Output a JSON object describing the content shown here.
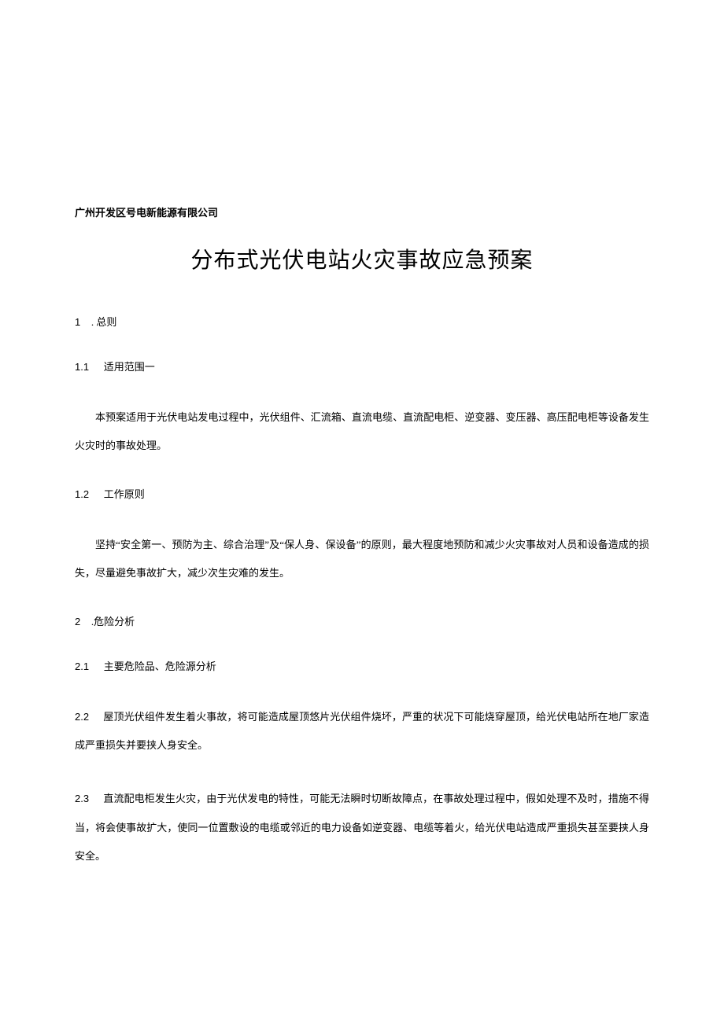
{
  "company": "广州开发区号电新能源有限公司",
  "title": "分布式光伏电站火灾事故应急预案",
  "s1": {
    "num": "1",
    "label": ". 总则"
  },
  "s1_1": {
    "num": "1.1",
    "label": "适用范围一"
  },
  "p1": "本预案适用于光伏电站发电过程中，光伏组件、汇流箱、直流电缆、直流配电柜、逆变器、变压器、高压配电柜等设备发生火灾时的事故处理。",
  "s1_2": {
    "num": "1.2",
    "label": "工作原则"
  },
  "p2": "坚持“安全第一、预防为主、综合治理”及“保人身、保设备”的原则，最大程度地预防和减少火灾事故对人员和设备造成的损失，尽量避免事故扩大，减少次生灾难的发生。",
  "s2": {
    "num": "2",
    "label": ".危险分析"
  },
  "s2_1": {
    "num": "2.1",
    "label": "主要危险品、危险源分析"
  },
  "s2_2": {
    "num": "2.2",
    "label": "屋顶光伏组件发生着火事故，将可能造成屋顶悠片光伏组件烧坏，严重的状况下可能烧穿屋顶，给光伏电站所在地厂家造成严重损失并要挟人身安全。"
  },
  "s2_3": {
    "num": "2.3",
    "label": "直流配电柜发生火灾，由于光伏发电的特性，可能无法瞬时切断故障点，在事故处理过程中，假如处理不及时，措施不得当，将会使事故扩大，使同一位置敷设的电缆或邻近的电力设备如逆变器、电缆等着火，给光伏电站造成严重损失甚至要挟人身安全。"
  }
}
